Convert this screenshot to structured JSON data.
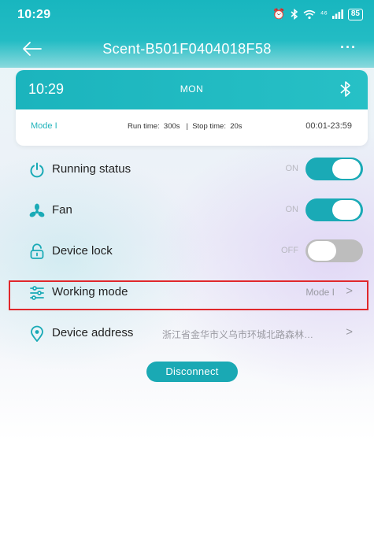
{
  "status_bar": {
    "time": "10:29",
    "network": "⁴⁶",
    "battery": "85"
  },
  "nav": {
    "title": "Scent-B501F0404018F58",
    "more": "···"
  },
  "schedule_card": {
    "time": "10:29",
    "day": "MON",
    "mode": "Mode I",
    "run_stop": "Run time:  300s   |  Stop time:  20s",
    "range": "00:01-23:59"
  },
  "rows": {
    "running_status": {
      "label": "Running status",
      "state": "ON",
      "on": true
    },
    "fan": {
      "label": "Fan",
      "state": "ON",
      "on": true
    },
    "device_lock": {
      "label": "Device lock",
      "state": "OFF",
      "on": false
    },
    "working_mode": {
      "label": "Working mode",
      "value": "Mode I",
      "chevron": ">"
    },
    "device_address": {
      "label": "Device address",
      "value": "浙江省金华市义乌市环城北路森林…",
      "chevron": ">"
    }
  },
  "disconnect_label": "Disconnect",
  "colors": {
    "accent": "#1aaab6",
    "highlight": "#e0282c",
    "toggle_off": "#bdbdbd"
  }
}
